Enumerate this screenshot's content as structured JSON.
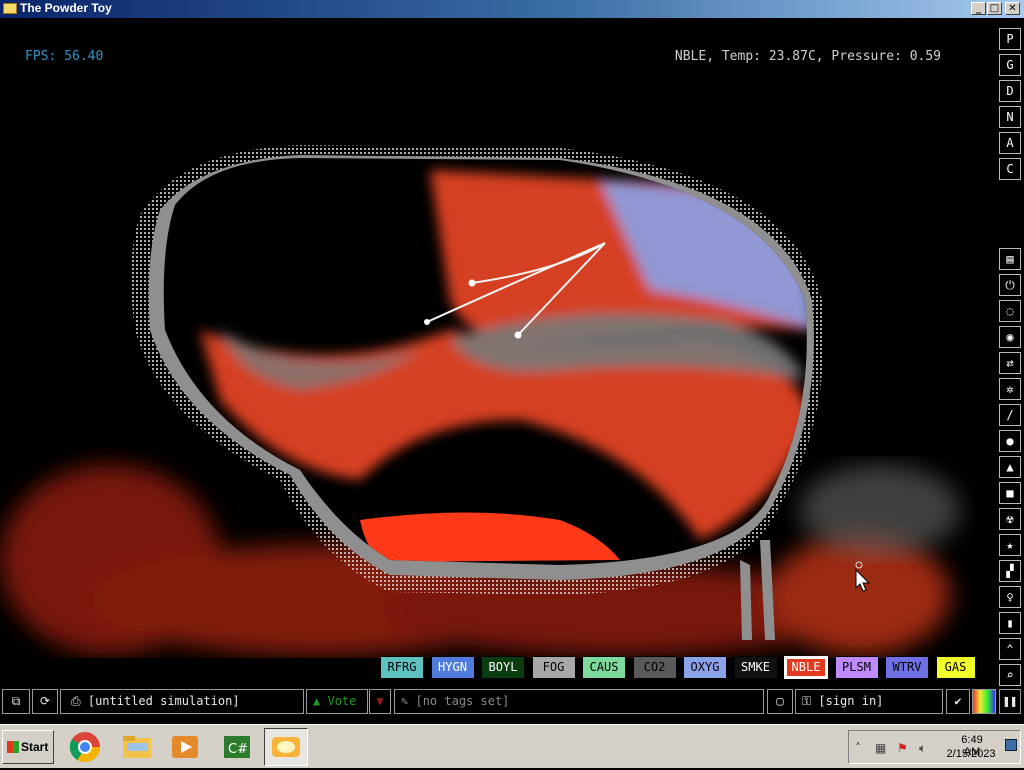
{
  "window": {
    "title": "The Powder Toy",
    "buttons": {
      "minimize": "_",
      "maximize": "□",
      "close": "✕"
    }
  },
  "hud": {
    "fps": "FPS: 56.40",
    "info": "NBLE, Temp: 23.87C, Pressure: 0.59"
  },
  "right_top_buttons": [
    "P",
    "G",
    "D",
    "N",
    "A",
    "C"
  ],
  "right_tool_icons": [
    "walls-icon",
    "electronics-icon",
    "powered-icon",
    "sensors-icon",
    "force-icon",
    "explosives-icon",
    "gases-icon",
    "liquids-icon",
    "powders-icon",
    "solids-icon",
    "radioactive-icon",
    "special-icon",
    "life-icon",
    "tools-icon",
    "favorites-icon",
    "decoration-icon",
    "search-icon"
  ],
  "palette": [
    {
      "label": "RFRG",
      "bg": "#5fc0c0",
      "fg": "#000000",
      "selected": false
    },
    {
      "label": "HYGN",
      "bg": "#4f7bdc",
      "fg": "#ffffff",
      "selected": false
    },
    {
      "label": "BOYL",
      "bg": "#0a3c10",
      "fg": "#ffffff",
      "selected": false
    },
    {
      "label": "FOG",
      "bg": "#a8a8a8",
      "fg": "#000000",
      "selected": false
    },
    {
      "label": "CAUS",
      "bg": "#7ed99c",
      "fg": "#000000",
      "selected": false
    },
    {
      "label": "CO2",
      "bg": "#5a5a5a",
      "fg": "#000000",
      "selected": false
    },
    {
      "label": "OXYG",
      "bg": "#8aa2e8",
      "fg": "#000000",
      "selected": false
    },
    {
      "label": "SMKE",
      "bg": "#111111",
      "fg": "#ffffff",
      "selected": false
    },
    {
      "label": "NBLE",
      "bg": "#e2391f",
      "fg": "#ffffff",
      "selected": true
    },
    {
      "label": "PLSM",
      "bg": "#c08aff",
      "fg": "#000000",
      "selected": false
    },
    {
      "label": "WTRV",
      "bg": "#7070e6",
      "fg": "#000000",
      "selected": false
    },
    {
      "label": "GAS",
      "bg": "#f0ff2a",
      "fg": "#000000",
      "selected": false
    }
  ],
  "bottom": {
    "sim_name": "[untitled simulation]",
    "vote": "Vote",
    "tags": "[no tags set]",
    "sign_in": "[sign in]"
  },
  "taskbar": {
    "start": "Start",
    "apps": [
      "chrome-icon",
      "file-explorer-icon",
      "media-player-icon",
      "csharp-app-icon",
      "powder-toy-icon"
    ],
    "time": "6:49 AM",
    "date": "2/15/2023"
  },
  "colors": {
    "fps": "#2f95c8",
    "glass": "#8f8f8f",
    "noble_gas": "#e2391f",
    "oxygen": "#8aa2e8"
  }
}
